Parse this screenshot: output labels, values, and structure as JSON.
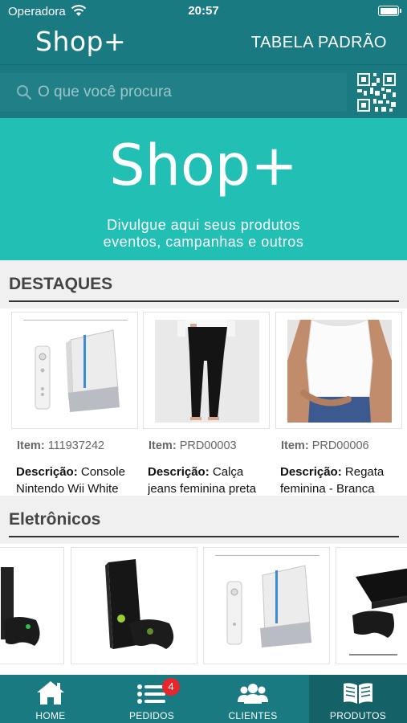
{
  "status_bar": {
    "carrier": "Operadora",
    "time": "20:57"
  },
  "header": {
    "logo": "Shop+",
    "table_name": "TABELA PADRÃO"
  },
  "search": {
    "placeholder": "O que você procura",
    "value": ""
  },
  "banner": {
    "logo": "Shop+",
    "line1": "Divulgue aqui seus produtos",
    "line2": "eventos, campanhas e outros"
  },
  "sections": {
    "destaques": {
      "title": "DESTAQUES",
      "products": [
        {
          "item_label": "Item:",
          "item_code": "111937242",
          "desc_label": "Descrição:",
          "description": "Console Nintendo Wii White",
          "image": "wii-console"
        },
        {
          "item_label": "Item:",
          "item_code": "PRD00003",
          "desc_label": "Descrição:",
          "description": "Calça jeans feminina preta",
          "image": "black-jeans"
        },
        {
          "item_label": "Item:",
          "item_code": "PRD00006",
          "desc_label": "Descrição:",
          "description": "Regata feminina - Branca",
          "image": "white-tank-top"
        }
      ]
    },
    "eletronicos": {
      "title": "Eletrônicos",
      "products": [
        {
          "image": "xbox-controller"
        },
        {
          "image": "xbox-360-console"
        },
        {
          "image": "wii-console"
        },
        {
          "image": "ps3-console"
        }
      ]
    }
  },
  "tabbar": {
    "tabs": [
      {
        "label": "HOME",
        "icon": "home-icon"
      },
      {
        "label": "PEDIDOS",
        "icon": "list-icon",
        "badge": "4"
      },
      {
        "label": "CLIENTES",
        "icon": "users-icon"
      },
      {
        "label": "PRODUTOS",
        "icon": "book-icon",
        "active": true
      }
    ]
  },
  "colors": {
    "primary": "#1a7a82",
    "banner": "#22bfb5",
    "badge": "#e8262b"
  }
}
